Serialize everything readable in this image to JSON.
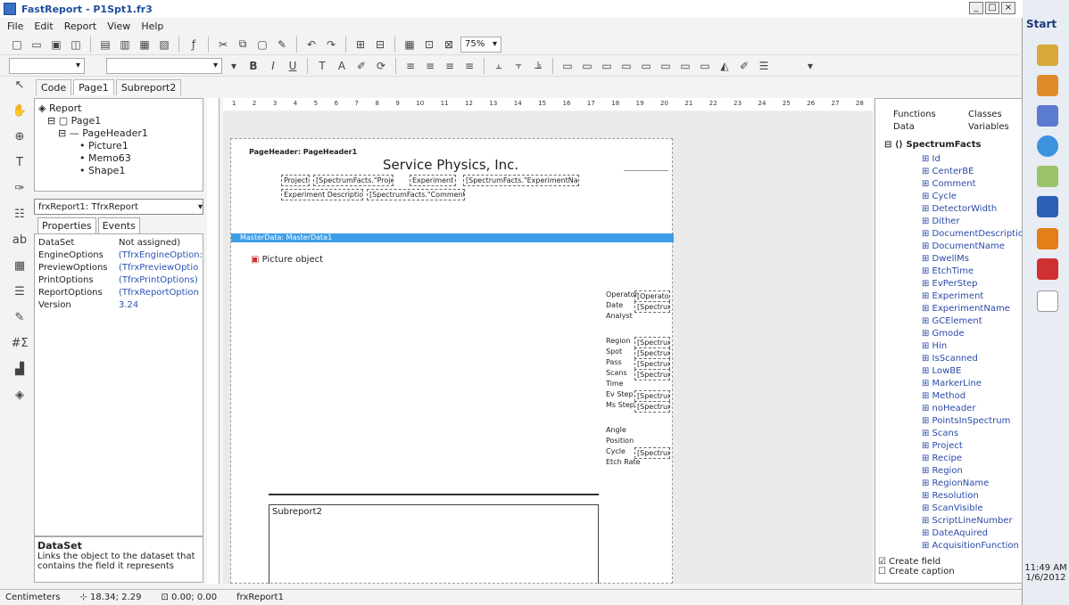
{
  "window": {
    "title": "FastReport - P1Spt1.fr3",
    "controls": [
      "_",
      "□",
      "×"
    ]
  },
  "menu": [
    "File",
    "Edit",
    "Report",
    "View",
    "Help"
  ],
  "toolbar": {
    "zoom": "75%",
    "format_font_b": "B",
    "format_font_i": "I",
    "format_font_u": "U"
  },
  "tabs": [
    "Code",
    "Page1",
    "Subreport2"
  ],
  "tree": {
    "report": "Report",
    "page": "Page1",
    "band": "PageHeader1",
    "items": [
      "Picture1",
      "Memo63",
      "Shape1"
    ]
  },
  "object_selector": "frxReport1: TfrxReport",
  "property_tabs": [
    "Properties",
    "Events"
  ],
  "properties": [
    {
      "name": "DataSet",
      "value": "Not assigned)"
    },
    {
      "name": "EngineOptions",
      "value": "(TfrxEngineOption:"
    },
    {
      "name": "PreviewOptions",
      "value": "(TfrxPreviewOptio"
    },
    {
      "name": "PrintOptions",
      "value": "(TfrxPrintOptions)"
    },
    {
      "name": "ReportOptions",
      "value": "(TfrxReportOption"
    },
    {
      "name": "Version",
      "value": "3.24"
    }
  ],
  "property_desc": {
    "title": "DataSet",
    "text": "Links the object to the dataset that contains the field it represents"
  },
  "ruler_numbers": [
    "1",
    "2",
    "3",
    "4",
    "5",
    "6",
    "7",
    "8",
    "9",
    "10",
    "11",
    "12",
    "13",
    "14",
    "15",
    "16",
    "17",
    "18",
    "19",
    "20",
    "21",
    "22",
    "23",
    "24",
    "25",
    "26",
    "27",
    "28"
  ],
  "design": {
    "page_header_label": "PageHeader: PageHeader1",
    "company": "Service Physics, Inc.",
    "memos_row1": [
      "Project",
      "[SpectrumFacts.\"Project\"]",
      "Experiment",
      "[SpectrumFacts.\"ExperimentName\"]"
    ],
    "memos_row2": [
      "Experiment Description",
      "[SpectrumFacts.\"Comment\"]"
    ],
    "master_label": "MasterData: MasterData1",
    "picture_label": "Picture object",
    "side_labels": [
      "Operator",
      "Date",
      "Analyst",
      "Region",
      "Spot",
      "Pass",
      "Scans",
      "Time",
      "Ev Step",
      "Ms Step",
      "Angle",
      "Position",
      "Cycle",
      "Etch Rate"
    ],
    "side_values": [
      "[Operator]",
      "[SpectrumF",
      "[SpectrumF",
      "[SpectrumF",
      "[SpectrumF",
      "[SpectrumF",
      "[SpectrumF",
      "[SpectrumF",
      "[Spectrum"
    ],
    "subreport": "Subreport2"
  },
  "right_tabs": [
    "Functions",
    "Classes",
    "Data",
    "Variables"
  ],
  "dataset_name": "SpectrumFacts",
  "fields": [
    "Id",
    "CenterBE",
    "Comment",
    "Cycle",
    "DetectorWidth",
    "Dither",
    "DocumentDescription",
    "DocumentName",
    "DwellMs",
    "EtchTime",
    "EvPerStep",
    "Experiment",
    "ExperimentName",
    "GCElement",
    "Gmode",
    "Hin",
    "IsScanned",
    "LowBE",
    "MarkerLine",
    "Method",
    "noHeader",
    "PointsInSpectrum",
    "Scans",
    "Project",
    "Recipe",
    "Region",
    "RegionName",
    "Resolution",
    "ScanVisible",
    "ScriptLineNumber",
    "DateAquired",
    "AcquisitionFunction"
  ],
  "checks": {
    "create_field": "Create field",
    "create_caption": "Create caption"
  },
  "status": {
    "units": "Centimeters",
    "pos": "18.34; 2.29",
    "size": "0.00; 0.00",
    "object": "frxReport1"
  },
  "taskbar": {
    "start": "Start",
    "time": "11:49 AM",
    "date": "1/6/2012"
  },
  "colors": {
    "band_blue": "#3d9ee8",
    "accent": "#1f4f9e"
  }
}
